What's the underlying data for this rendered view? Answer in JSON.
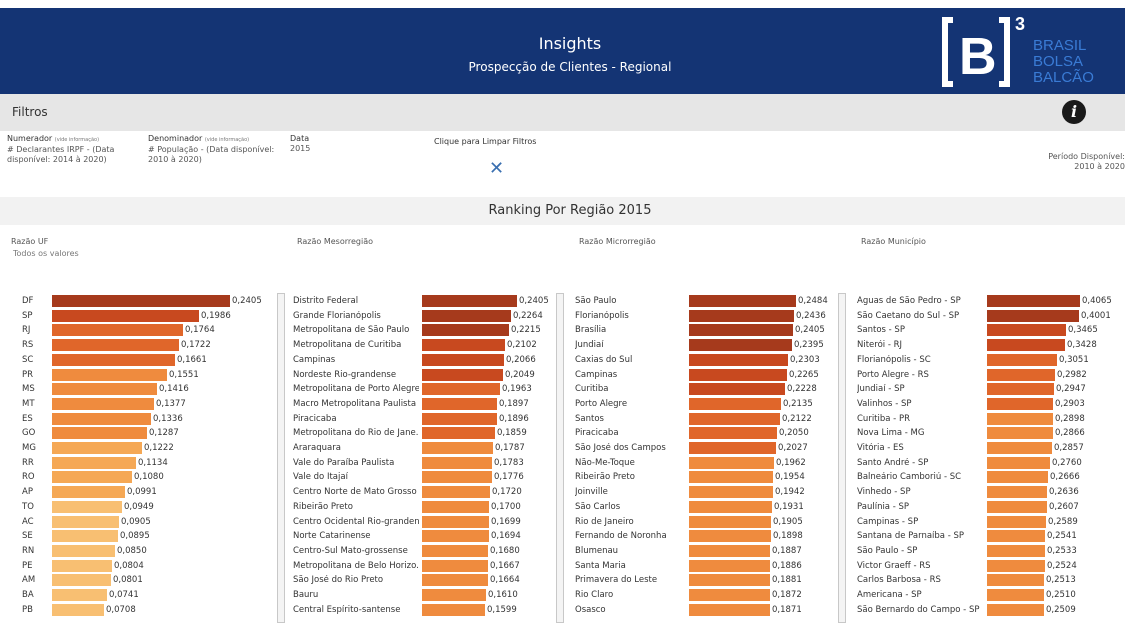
{
  "header": {
    "title": "Insights",
    "subtitle": "Prospecção de Clientes - Regional",
    "logo_text": [
      "BRASIL",
      "BOLSA",
      "BALCÃO"
    ],
    "logo_mark": "[B]³"
  },
  "filters": {
    "label": "Filtros",
    "info_icon": "info-icon",
    "numerador": {
      "title": "Numerador",
      "note": "(vide informação)",
      "value": "# Declarantes IRPF - (Data disponível: 2014 à 2020)"
    },
    "denominador": {
      "title": "Denominador",
      "note": "(vide informação)",
      "value": "# População - (Data disponível: 2010 à 2020)"
    },
    "data": {
      "title": "Data",
      "value": "2015"
    },
    "clear_label": "Clique para Limpar Filtros",
    "clear_icon": "close-icon",
    "period_label": "Período Disponível:",
    "period_value": "2010 à 2020"
  },
  "ranking": {
    "title": "Ranking Por Região 2015",
    "columns": [
      {
        "title": "Razão UF",
        "subtitle": "Todos os valores"
      },
      {
        "title": "Razão Mesorregião"
      },
      {
        "title": "Razão Microrregião"
      },
      {
        "title": "Razão Município"
      }
    ]
  },
  "colors": {
    "header_bg": "#143474",
    "bar_darkest": "#a63a1c",
    "bar_dark": "#c8491f",
    "bar_mid": "#e0662a",
    "bar_light": "#ef8b3e",
    "bar_lighter": "#f5a855",
    "bar_lightest": "#f8bf72"
  },
  "chart_data": [
    {
      "type": "bar",
      "title": "Razão UF",
      "categories": [
        "DF",
        "SP",
        "RJ",
        "RS",
        "SC",
        "PR",
        "MS",
        "MT",
        "ES",
        "GO",
        "MG",
        "RR",
        "RO",
        "AP",
        "TO",
        "AC",
        "SE",
        "RN",
        "PE",
        "AM",
        "BA",
        "PB"
      ],
      "values": [
        0.2405,
        0.1986,
        0.1764,
        0.1722,
        0.1661,
        0.1551,
        0.1416,
        0.1377,
        0.1336,
        0.1287,
        0.1222,
        0.1134,
        0.108,
        0.0991,
        0.0949,
        0.0905,
        0.0895,
        0.085,
        0.0804,
        0.0801,
        0.0741,
        0.0708
      ],
      "labels": [
        "0,2405",
        "0,1986",
        "0,1764",
        "0,1722",
        "0,1661",
        "0,1551",
        "0,1416",
        "0,1377",
        "0,1336",
        "0,1287",
        "0,1222",
        "0,1134",
        "0,1080",
        "0,0991",
        "0,0949",
        "0,0905",
        "0,0895",
        "0,0850",
        "0,0804",
        "0,0801",
        "0,0741",
        "0,0708"
      ]
    },
    {
      "type": "bar",
      "title": "Razão Mesorregião",
      "categories": [
        "Distrito Federal",
        "Grande Florianópolis",
        "Metropolitana de São Paulo",
        "Metropolitana de Curitiba",
        "Campinas",
        "Nordeste Rio-grandense",
        "Metropolitana de Porto Alegre",
        "Macro Metropolitana Paulista",
        "Piracicaba",
        "Metropolitana do Rio de Jane..",
        "Araraquara",
        "Vale do Paraíba Paulista",
        "Vale do Itajaí",
        "Centro Norte de Mato Grosso ..",
        "Ribeirão Preto",
        "Centro Ocidental Rio-granden..",
        "Norte Catarinense",
        "Centro-Sul Mato-grossense",
        "Metropolitana de Belo Horizo..",
        "São José do Rio Preto",
        "Bauru",
        "Central Espírito-santense"
      ],
      "values": [
        0.2405,
        0.2264,
        0.2215,
        0.2102,
        0.2066,
        0.2049,
        0.1963,
        0.1897,
        0.1896,
        0.1859,
        0.1787,
        0.1783,
        0.1776,
        0.172,
        0.17,
        0.1699,
        0.1694,
        0.168,
        0.1667,
        0.1664,
        0.161,
        0.1599
      ],
      "labels": [
        "0,2405",
        "0,2264",
        "0,2215",
        "0,2102",
        "0,2066",
        "0,2049",
        "0,1963",
        "0,1897",
        "0,1896",
        "0,1859",
        "0,1787",
        "0,1783",
        "0,1776",
        "0,1720",
        "0,1700",
        "0,1699",
        "0,1694",
        "0,1680",
        "0,1667",
        "0,1664",
        "0,1610",
        "0,1599"
      ]
    },
    {
      "type": "bar",
      "title": "Razão Microrregião",
      "categories": [
        "São Paulo",
        "Florianópolis",
        "Brasília",
        "Jundiaí",
        "Caxias do Sul",
        "Campinas",
        "Curitiba",
        "Porto Alegre",
        "Santos",
        "Piracicaba",
        "São José dos Campos",
        "Não-Me-Toque",
        "Ribeirão Preto",
        "Joinville",
        "São Carlos",
        "Rio de Janeiro",
        "Fernando de Noronha",
        "Blumenau",
        "Santa Maria",
        "Primavera do Leste",
        "Rio Claro",
        "Osasco"
      ],
      "values": [
        0.2484,
        0.2436,
        0.2405,
        0.2395,
        0.2303,
        0.2265,
        0.2228,
        0.2135,
        0.2122,
        0.205,
        0.2027,
        0.1962,
        0.1954,
        0.1942,
        0.1931,
        0.1905,
        0.1898,
        0.1887,
        0.1886,
        0.1881,
        0.1872,
        0.1871
      ],
      "labels": [
        "0,2484",
        "0,2436",
        "0,2405",
        "0,2395",
        "0,2303",
        "0,2265",
        "0,2228",
        "0,2135",
        "0,2122",
        "0,2050",
        "0,2027",
        "0,1962",
        "0,1954",
        "0,1942",
        "0,1931",
        "0,1905",
        "0,1898",
        "0,1887",
        "0,1886",
        "0,1881",
        "0,1872",
        "0,1871"
      ]
    },
    {
      "type": "bar",
      "title": "Razão Município",
      "categories": [
        "Águas de São Pedro - SP",
        "São Caetano do Sul - SP",
        "Santos - SP",
        "Niterói - RJ",
        "Florianópolis - SC",
        "Porto Alegre - RS",
        "Jundiaí - SP",
        "Valinhos - SP",
        "Curitiba - PR",
        "Nova Lima - MG",
        "Vitória - ES",
        "Santo André - SP",
        "Balneário Camboriú - SC",
        "Vinhedo - SP",
        "Paulínia - SP",
        "Campinas - SP",
        "Santana de Parnaíba - SP",
        "São Paulo - SP",
        "Victor Graeff - RS",
        "Carlos Barbosa - RS",
        "Americana - SP",
        "São Bernardo do Campo - SP"
      ],
      "values": [
        0.4065,
        0.4001,
        0.3465,
        0.3428,
        0.3051,
        0.2982,
        0.2947,
        0.2903,
        0.2898,
        0.2866,
        0.2857,
        0.276,
        0.2666,
        0.2636,
        0.2607,
        0.2589,
        0.2541,
        0.2533,
        0.2524,
        0.2513,
        0.251,
        0.2509
      ],
      "labels": [
        "0,4065",
        "0,4001",
        "0,3465",
        "0,3428",
        "0,3051",
        "0,2982",
        "0,2947",
        "0,2903",
        "0,2898",
        "0,2866",
        "0,2857",
        "0,2760",
        "0,2666",
        "0,2636",
        "0,2607",
        "0,2589",
        "0,2541",
        "0,2533",
        "0,2524",
        "0,2513",
        "0,2510",
        "0,2509"
      ]
    }
  ]
}
